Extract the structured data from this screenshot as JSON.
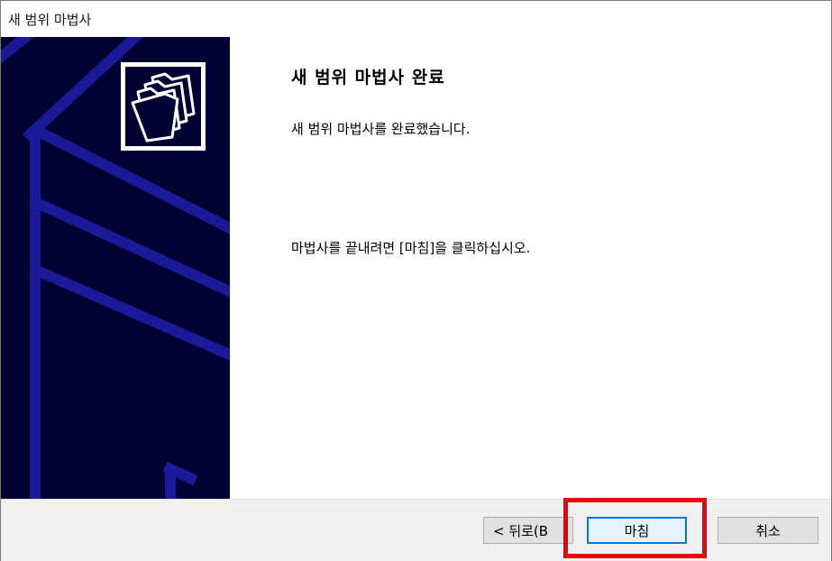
{
  "window": {
    "title": "새 범위 마법사"
  },
  "content": {
    "heading": "새 범위 마법사 완료",
    "description": "새 범위 마법사를 완료했습니다.",
    "instruction": "마법사를 끝내려면 [마침]을 클릭하십시오."
  },
  "buttons": {
    "back_label": "< 뒤로(B",
    "finish_label": "마침",
    "cancel_label": "취소"
  },
  "colors": {
    "side_panel": "#000033",
    "panel_lines": "#1a1a99",
    "finish_border": "#0078d7",
    "highlight": "#e8000b"
  },
  "icons": {
    "wizard": "folders-icon"
  }
}
